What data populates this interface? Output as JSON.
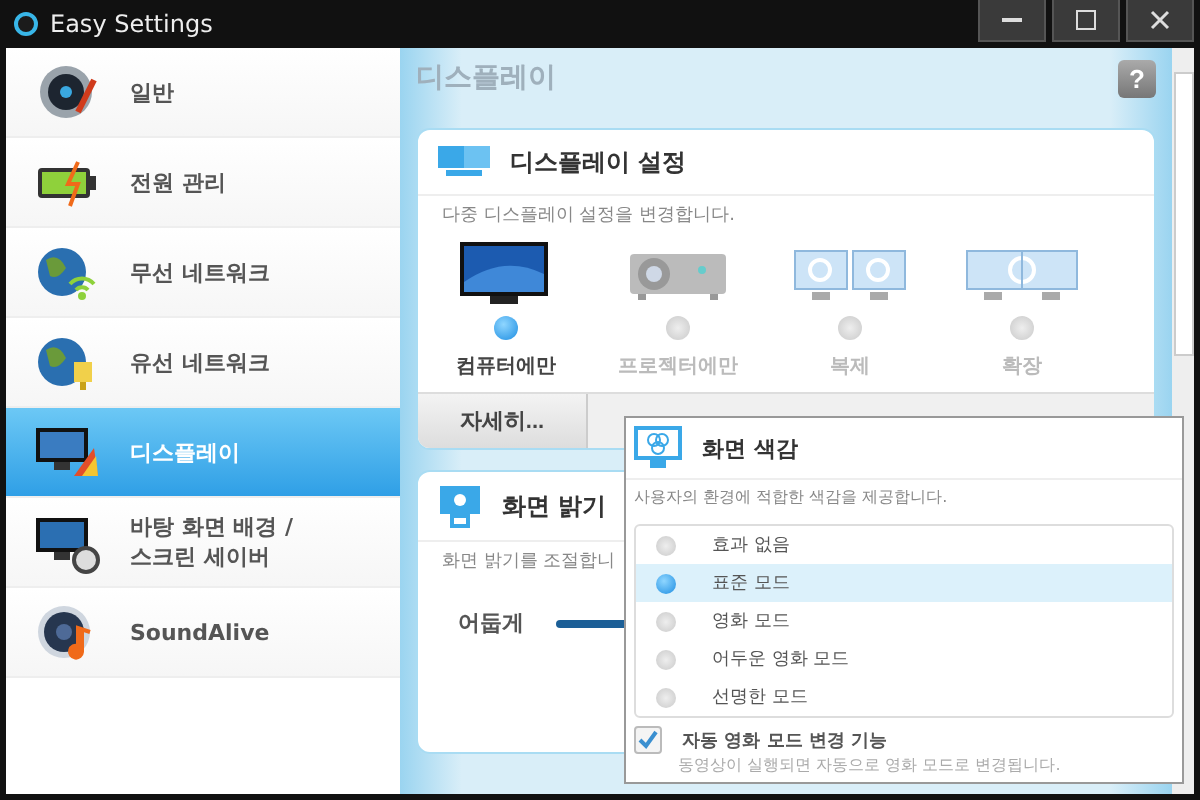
{
  "window": {
    "title": "Easy Settings"
  },
  "sidebar": {
    "items": [
      {
        "kind": "general",
        "label": "일반",
        "selected": false
      },
      {
        "kind": "power",
        "label": "전원 관리",
        "selected": false
      },
      {
        "kind": "wireless",
        "label": "무선 네트워크",
        "selected": false
      },
      {
        "kind": "wired",
        "label": "유선 네트워크",
        "selected": false
      },
      {
        "kind": "display",
        "label": "디스플레이",
        "selected": true
      },
      {
        "kind": "wallpaper",
        "label": "바탕 화면 배경 /\n스크린 세이버",
        "selected": false
      },
      {
        "kind": "sound",
        "label": "SoundAlive",
        "selected": false
      }
    ]
  },
  "page_title": "디스플레이",
  "help_button": "?",
  "display_settings": {
    "title": "디스플레이 설정",
    "description": "다중 디스플레이 설정을 변경합니다.",
    "options": [
      {
        "kind": "computer",
        "label": "컴퓨터에만",
        "selected": true
      },
      {
        "kind": "projector",
        "label": "프로젝터에만",
        "selected": false
      },
      {
        "kind": "duplicate",
        "label": "복제",
        "selected": false
      },
      {
        "kind": "extend",
        "label": "확장",
        "selected": false
      }
    ],
    "details_button": "자세히..."
  },
  "brightness": {
    "title": "화면 밝기",
    "description": "화면 밝기를 조절합니",
    "min_label": "어둡게"
  },
  "color_popup": {
    "title": "화면 색감",
    "description": "사용자의 환경에 적합한 색감을 제공합니다.",
    "modes": [
      {
        "label": "효과 없음",
        "selected": false
      },
      {
        "label": "표준 모드",
        "selected": true
      },
      {
        "label": "영화 모드",
        "selected": false
      },
      {
        "label": "어두운 영화 모드",
        "selected": false
      },
      {
        "label": "선명한 모드",
        "selected": false
      }
    ],
    "auto_mode": {
      "label": "자동 영화 모드 변경 기능",
      "checked": true,
      "description": "동영상이 실행되면 자동으로 영화 모드로 변경됩니다."
    }
  }
}
